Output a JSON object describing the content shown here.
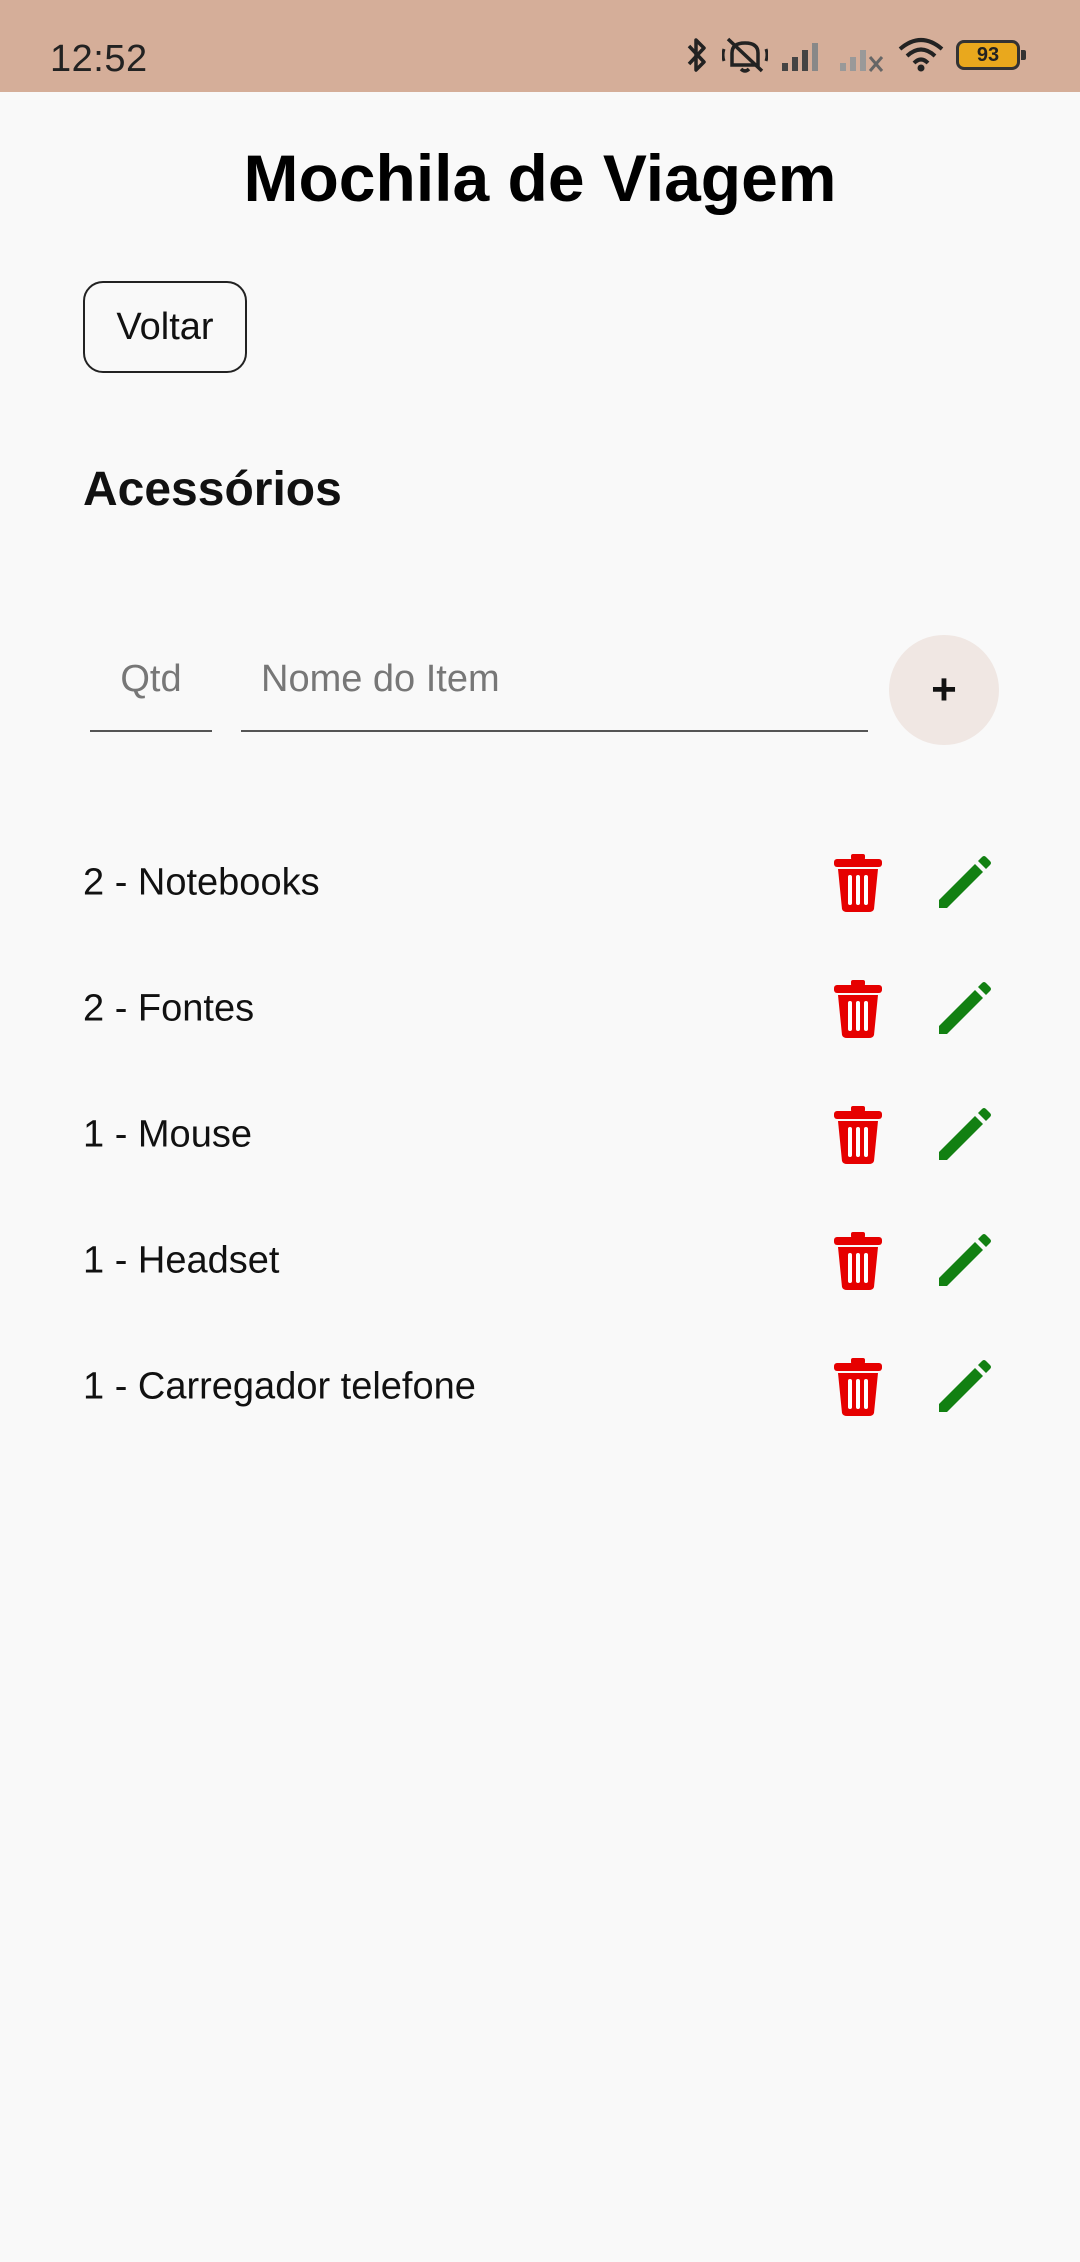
{
  "status_bar": {
    "time": "12:52",
    "battery": "93",
    "icons": [
      "bluetooth-icon",
      "silent-icon",
      "signal-icon",
      "signal-off-icon",
      "wifi-icon",
      "battery-icon"
    ]
  },
  "page": {
    "title": "Mochila de Viagem",
    "back_label": "Voltar",
    "section_title": "Acessórios"
  },
  "form": {
    "qty_placeholder": "Qtd",
    "name_placeholder": "Nome do Item",
    "add_label": "+"
  },
  "items": [
    {
      "label": "2 - Notebooks"
    },
    {
      "label": "2 - Fontes"
    },
    {
      "label": "1 - Mouse"
    },
    {
      "label": "1 - Headset"
    },
    {
      "label": "1 - Carregador telefone"
    }
  ],
  "colors": {
    "status_bar": "#d5ae99",
    "background": "#f9f9f9",
    "delete_icon": "#e60000",
    "edit_icon": "#128012",
    "add_button_bg": "#f0e7e3"
  }
}
